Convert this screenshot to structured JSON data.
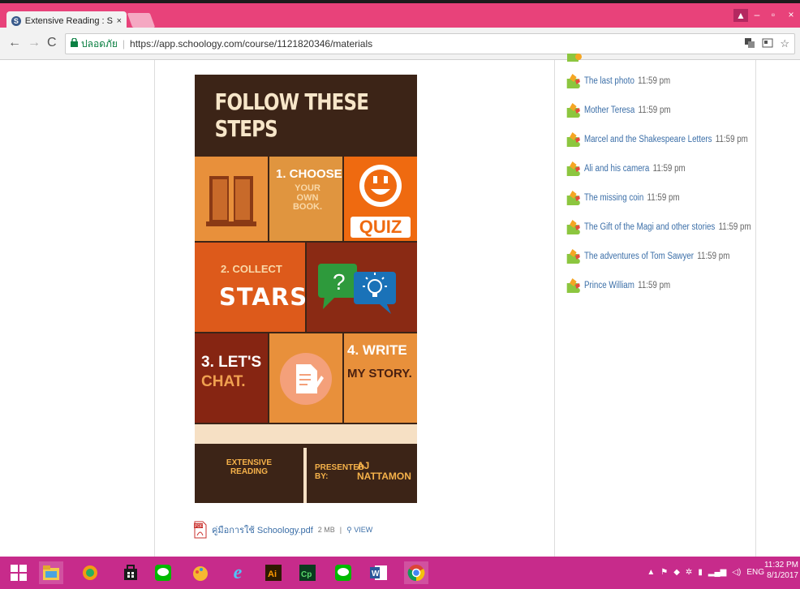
{
  "browser": {
    "tab_title": "Extensive Reading : Secti",
    "tab_close": "×",
    "security_label": "ปลอดภัย",
    "url": "https://app.schoology.com/course/1121820346/materials",
    "nav_back": "←",
    "nav_forward": "→",
    "nav_reload": "C",
    "window_controls": {
      "user": "▲",
      "minimize": "–",
      "maximize": "▫",
      "close": "×"
    }
  },
  "poster": {
    "title": "FOLLOW THESE STEPS",
    "step1_head": "1. CHOOSE",
    "step1_sub": "YOUR OWN BOOK.",
    "quiz": "QUIZ",
    "step2_head": "2. COLLECT",
    "step2_sub": "STARS.",
    "bubble_q": "?",
    "step3_a": "3. LET'S",
    "step3_b": "CHAT.",
    "step4_a": "4. WRITE",
    "step4_b": "MY STORY.",
    "footer_left": "EXTENSIVE READING",
    "footer_presented": "PRESENTED BY:",
    "footer_author": "AJ NATTAMON"
  },
  "attachment": {
    "filename": "คู่มือการใช้ Schoology.pdf",
    "size": "2 MB",
    "sep": "|",
    "view": "VIEW"
  },
  "assignments": [
    {
      "name": "The last photo",
      "time": "11:59 pm"
    },
    {
      "name": "Mother Teresa",
      "time": "11:59 pm"
    },
    {
      "name": "Marcel and the Shakespeare Letters",
      "time": "11:59 pm"
    },
    {
      "name": "Ali and his camera",
      "time": "11:59 pm"
    },
    {
      "name": "The missing coin",
      "time": "11:59 pm"
    },
    {
      "name": "The Gift of the Magi and other stories",
      "time": "11:59 pm"
    },
    {
      "name": "The adventures of Tom Sawyer",
      "time": "11:59 pm"
    },
    {
      "name": "Prince William",
      "time": "11:59 pm"
    }
  ],
  "taskbar": {
    "language": "ENG",
    "time": "11:32 PM",
    "date": "8/1/2017"
  },
  "colors": {
    "tabbar": "#e8427a",
    "taskbar": "#c72b8b",
    "link": "#3c6fa8"
  }
}
